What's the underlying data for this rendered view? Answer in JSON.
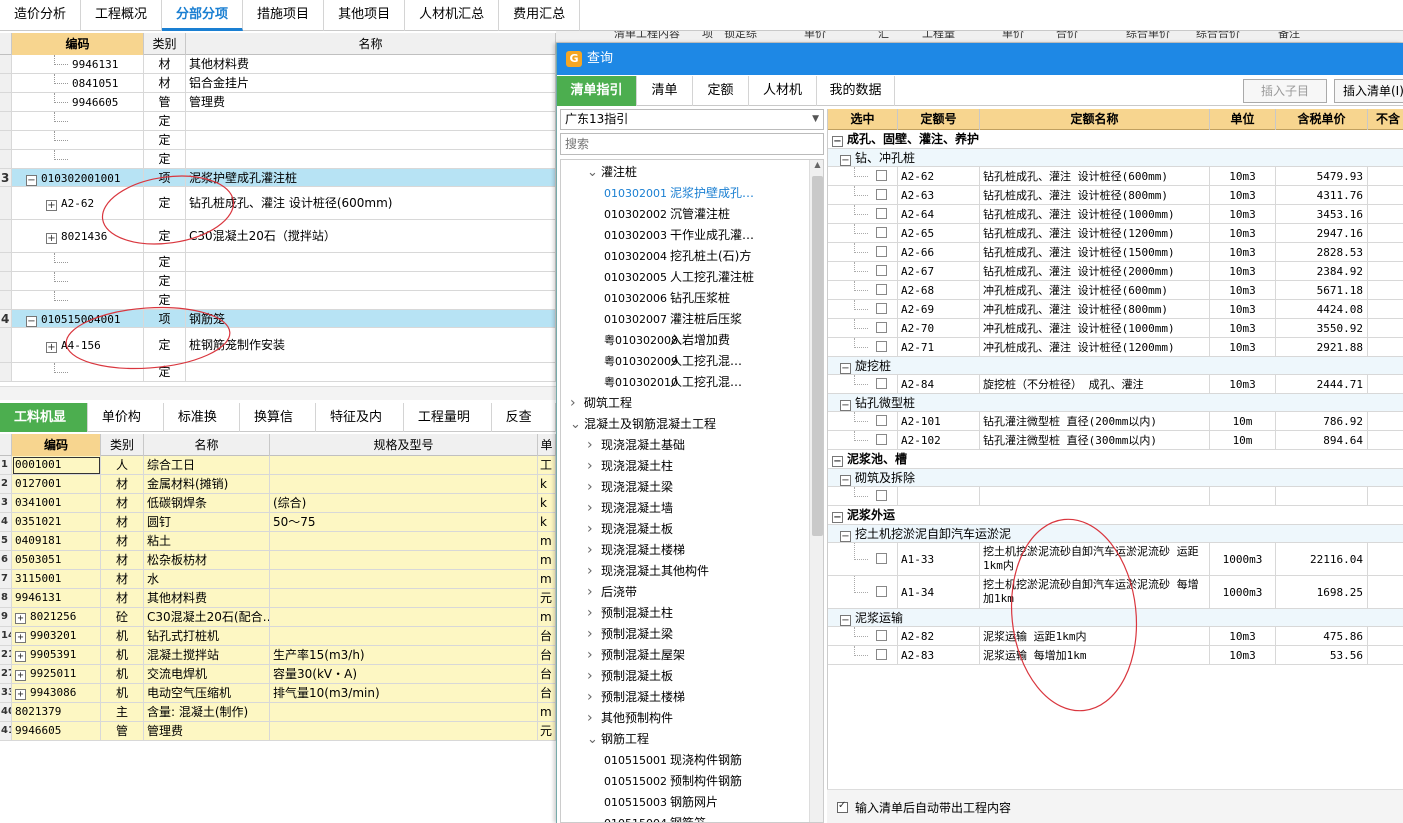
{
  "top_tabs": [
    "造价分析",
    "工程概况",
    "分部分项",
    "措施项目",
    "其他项目",
    "人材机汇总",
    "费用汇总"
  ],
  "upper_grid": {
    "headers": {
      "code": "编码",
      "type": "类别",
      "name": "名称"
    },
    "rows": [
      {
        "rn": "",
        "code": "9946131",
        "type": "材",
        "name": "其他材料费"
      },
      {
        "rn": "",
        "code": "0841051",
        "type": "材",
        "name": "铝合金挂片"
      },
      {
        "rn": "",
        "code": "9946605",
        "type": "管",
        "name": "管理费"
      },
      {
        "rn": "",
        "code": "",
        "type": "定",
        "name": ""
      },
      {
        "rn": "",
        "code": "",
        "type": "定",
        "name": ""
      },
      {
        "rn": "",
        "code": "",
        "type": "定",
        "name": ""
      },
      {
        "rn": "3",
        "code": "010302001001",
        "type": "项",
        "name": "泥浆护壁成孔灌注桩"
      },
      {
        "rn": "",
        "code": "A2-62",
        "type": "定",
        "name": "钻孔桩成孔、灌注 设计桩径(600mm)"
      },
      {
        "rn": "",
        "code": "8021436",
        "type": "定",
        "name": "C30混凝土20石（搅拌站）"
      },
      {
        "rn": "",
        "code": "",
        "type": "定",
        "name": ""
      },
      {
        "rn": "",
        "code": "",
        "type": "定",
        "name": ""
      },
      {
        "rn": "",
        "code": "",
        "type": "定",
        "name": ""
      },
      {
        "rn": "4",
        "code": "010515004001",
        "type": "项",
        "name": "钢筋笼"
      },
      {
        "rn": "",
        "code": "A4-156",
        "type": "定",
        "name": "桩钢筋笼制作安装"
      },
      {
        "rn": "",
        "code": "",
        "type": "定",
        "name": ""
      }
    ]
  },
  "lower_tabs": [
    "工料机显示",
    "单价构成",
    "标准换算",
    "换算信息",
    "特征及内容",
    "工程量明细",
    "反查图"
  ],
  "lower_grid": {
    "headers": {
      "code": "编码",
      "type": "类别",
      "name": "名称",
      "spec": "规格及型号",
      "unit": "单"
    },
    "rows": [
      {
        "rn": "1",
        "code": "0001001",
        "type": "人",
        "name": "综合工日",
        "spec": "",
        "unit": "工"
      },
      {
        "rn": "2",
        "code": "0127001",
        "type": "材",
        "name": "金属材料(摊销)",
        "spec": "",
        "unit": "k"
      },
      {
        "rn": "3",
        "code": "0341001",
        "type": "材",
        "name": "低碳钢焊条",
        "spec": "(综合)",
        "unit": "k"
      },
      {
        "rn": "4",
        "code": "0351021",
        "type": "材",
        "name": "圆钉",
        "spec": "50～75",
        "unit": "k"
      },
      {
        "rn": "5",
        "code": "0409181",
        "type": "材",
        "name": "粘土",
        "spec": "",
        "unit": "m"
      },
      {
        "rn": "6",
        "code": "0503051",
        "type": "材",
        "name": "松杂板枋材",
        "spec": "",
        "unit": "m"
      },
      {
        "rn": "7",
        "code": "3115001",
        "type": "材",
        "name": "水",
        "spec": "",
        "unit": "m"
      },
      {
        "rn": "8",
        "code": "9946131",
        "type": "材",
        "name": "其他材料费",
        "spec": "",
        "unit": "元"
      },
      {
        "rn": "9",
        "code": "8021256",
        "type": "砼",
        "name": "C30混凝土20石(配合…",
        "spec": "",
        "unit": "m"
      },
      {
        "rn": "14",
        "code": "9903201",
        "type": "机",
        "name": "钻孔式打桩机",
        "spec": "",
        "unit": "台"
      },
      {
        "rn": "21",
        "code": "9905391",
        "type": "机",
        "name": "混凝土搅拌站",
        "spec": "生产率15(m3/h)",
        "unit": "台"
      },
      {
        "rn": "27",
        "code": "9925011",
        "type": "机",
        "name": "交流电焊机",
        "spec": "容量30(kV・A)",
        "unit": "台"
      },
      {
        "rn": "33",
        "code": "9943086",
        "type": "机",
        "name": "电动空气压缩机",
        "spec": "排气量10(m3/min)",
        "unit": "台"
      },
      {
        "rn": "40",
        "code": "8021379",
        "type": "主",
        "name": "含量: 混凝土(制作)",
        "spec": "",
        "unit": "m"
      },
      {
        "rn": "41",
        "code": "9946605",
        "type": "管",
        "name": "管理费",
        "spec": "",
        "unit": "元"
      }
    ]
  },
  "behind_header": [
    "清单工程内容",
    "项",
    "锁定综",
    "单价",
    "汇",
    "工程量",
    "单价",
    "合价",
    "综合单价",
    "综合合价",
    "备注"
  ],
  "dialog": {
    "title": "查询",
    "tabs": [
      "清单指引",
      "清单",
      "定额",
      "人材机",
      "我的数据"
    ],
    "btn_insert_sub": "插入子目",
    "btn_insert_list": "插入清单(I)",
    "guide_select": "广东13指引",
    "search_placeholder": "搜索",
    "tree": [
      {
        "indent": 3,
        "arrow": "open",
        "code": "",
        "label": "灌注桩",
        "active": false
      },
      {
        "indent": 4,
        "arrow": "",
        "code": "010302001",
        "label": "泥浆护壁成孔…",
        "active": true
      },
      {
        "indent": 4,
        "arrow": "",
        "code": "010302002",
        "label": "沉管灌注桩",
        "active": false
      },
      {
        "indent": 4,
        "arrow": "",
        "code": "010302003",
        "label": "干作业成孔灌…",
        "active": false
      },
      {
        "indent": 4,
        "arrow": "",
        "code": "010302004",
        "label": "挖孔桩土(石)方",
        "active": false
      },
      {
        "indent": 4,
        "arrow": "",
        "code": "010302005",
        "label": "人工挖孔灌注桩",
        "active": false
      },
      {
        "indent": 4,
        "arrow": "",
        "code": "010302006",
        "label": "钻孔压浆桩",
        "active": false
      },
      {
        "indent": 4,
        "arrow": "",
        "code": "010302007",
        "label": "灌注桩后压浆",
        "active": false
      },
      {
        "indent": 4,
        "arrow": "",
        "code": "粤010302008",
        "label": "入岩增加费",
        "active": false
      },
      {
        "indent": 4,
        "arrow": "",
        "code": "粤010302009",
        "label": "人工挖孔混…",
        "active": false
      },
      {
        "indent": 4,
        "arrow": "",
        "code": "粤010302010",
        "label": "人工挖孔混…",
        "active": false
      },
      {
        "indent": 2,
        "arrow": "closed",
        "code": "",
        "label": "砌筑工程",
        "active": false
      },
      {
        "indent": 2,
        "arrow": "open",
        "code": "",
        "label": "混凝土及钢筋混凝土工程",
        "active": false
      },
      {
        "indent": 3,
        "arrow": "closed",
        "code": "",
        "label": "现浇混凝土基础",
        "active": false
      },
      {
        "indent": 3,
        "arrow": "closed",
        "code": "",
        "label": "现浇混凝土柱",
        "active": false
      },
      {
        "indent": 3,
        "arrow": "closed",
        "code": "",
        "label": "现浇混凝土梁",
        "active": false
      },
      {
        "indent": 3,
        "arrow": "closed",
        "code": "",
        "label": "现浇混凝土墙",
        "active": false
      },
      {
        "indent": 3,
        "arrow": "closed",
        "code": "",
        "label": "现浇混凝土板",
        "active": false
      },
      {
        "indent": 3,
        "arrow": "closed",
        "code": "",
        "label": "现浇混凝土楼梯",
        "active": false
      },
      {
        "indent": 3,
        "arrow": "closed",
        "code": "",
        "label": "现浇混凝土其他构件",
        "active": false
      },
      {
        "indent": 3,
        "arrow": "closed",
        "code": "",
        "label": "后浇带",
        "active": false
      },
      {
        "indent": 3,
        "arrow": "closed",
        "code": "",
        "label": "预制混凝土柱",
        "active": false
      },
      {
        "indent": 3,
        "arrow": "closed",
        "code": "",
        "label": "预制混凝土梁",
        "active": false
      },
      {
        "indent": 3,
        "arrow": "closed",
        "code": "",
        "label": "预制混凝土屋架",
        "active": false
      },
      {
        "indent": 3,
        "arrow": "closed",
        "code": "",
        "label": "预制混凝土板",
        "active": false
      },
      {
        "indent": 3,
        "arrow": "closed",
        "code": "",
        "label": "预制混凝土楼梯",
        "active": false
      },
      {
        "indent": 3,
        "arrow": "closed",
        "code": "",
        "label": "其他预制构件",
        "active": false
      },
      {
        "indent": 3,
        "arrow": "open",
        "code": "",
        "label": "钢筋工程",
        "active": false
      },
      {
        "indent": 4,
        "arrow": "",
        "code": "010515001",
        "label": "现浇构件钢筋",
        "active": false
      },
      {
        "indent": 4,
        "arrow": "",
        "code": "010515002",
        "label": "预制构件钢筋",
        "active": false
      },
      {
        "indent": 4,
        "arrow": "",
        "code": "010515003",
        "label": "钢筋网片",
        "active": false
      },
      {
        "indent": 4,
        "arrow": "",
        "code": "010515004",
        "label": "钢筋笼",
        "active": false
      }
    ],
    "table_headers": {
      "select": "选中",
      "code": "定额号",
      "name": "定额名称",
      "unit": "单位",
      "price": "含税单价",
      "extra": "不含"
    },
    "table": [
      {
        "kind": "group",
        "label": "成孔、固壁、灌注、养护"
      },
      {
        "kind": "sub",
        "label": "钻、冲孔桩"
      },
      {
        "kind": "row",
        "code": "A2-62",
        "name": "钻孔桩成孔、灌注 设计桩径(600mm)",
        "unit": "10m3",
        "price": "5479.93"
      },
      {
        "kind": "row",
        "code": "A2-63",
        "name": "钻孔桩成孔、灌注 设计桩径(800mm)",
        "unit": "10m3",
        "price": "4311.76"
      },
      {
        "kind": "row",
        "code": "A2-64",
        "name": "钻孔桩成孔、灌注 设计桩径(1000mm)",
        "unit": "10m3",
        "price": "3453.16"
      },
      {
        "kind": "row",
        "code": "A2-65",
        "name": "钻孔桩成孔、灌注 设计桩径(1200mm)",
        "unit": "10m3",
        "price": "2947.16"
      },
      {
        "kind": "row",
        "code": "A2-66",
        "name": "钻孔桩成孔、灌注 设计桩径(1500mm)",
        "unit": "10m3",
        "price": "2828.53"
      },
      {
        "kind": "row",
        "code": "A2-67",
        "name": "钻孔桩成孔、灌注 设计桩径(2000mm)",
        "unit": "10m3",
        "price": "2384.92"
      },
      {
        "kind": "row",
        "code": "A2-68",
        "name": "冲孔桩成孔、灌注 设计桩径(600mm)",
        "unit": "10m3",
        "price": "5671.18"
      },
      {
        "kind": "row",
        "code": "A2-69",
        "name": "冲孔桩成孔、灌注 设计桩径(800mm)",
        "unit": "10m3",
        "price": "4424.08"
      },
      {
        "kind": "row",
        "code": "A2-70",
        "name": "冲孔桩成孔、灌注 设计桩径(1000mm)",
        "unit": "10m3",
        "price": "3550.92"
      },
      {
        "kind": "row",
        "code": "A2-71",
        "name": "冲孔桩成孔、灌注 设计桩径(1200mm)",
        "unit": "10m3",
        "price": "2921.88"
      },
      {
        "kind": "sub",
        "label": "旋挖桩"
      },
      {
        "kind": "row",
        "code": "A2-84",
        "name": "旋挖桩（不分桩径） 成孔、灌注",
        "unit": "10m3",
        "price": "2444.71"
      },
      {
        "kind": "sub",
        "label": "钻孔微型桩"
      },
      {
        "kind": "row",
        "code": "A2-101",
        "name": "钻孔灌注微型桩 直径(200mm以内)",
        "unit": "10m",
        "price": "786.92"
      },
      {
        "kind": "row",
        "code": "A2-102",
        "name": "钻孔灌注微型桩 直径(300mm以内)",
        "unit": "10m",
        "price": "894.64"
      },
      {
        "kind": "group",
        "label": "泥浆池、槽"
      },
      {
        "kind": "sub",
        "label": "砌筑及拆除"
      },
      {
        "kind": "row",
        "code": "",
        "name": "",
        "unit": "",
        "price": ""
      },
      {
        "kind": "group",
        "label": "泥浆外运"
      },
      {
        "kind": "sub",
        "label": "挖土机挖淤泥自卸汽车运淤泥"
      },
      {
        "kind": "row2",
        "code": "A1-33",
        "name": "挖土机挖淤泥流砂自卸汽车运淤泥流砂 运距1km内",
        "unit": "1000m3",
        "price": "22116.04"
      },
      {
        "kind": "row2",
        "code": "A1-34",
        "name": "挖土机挖淤泥流砂自卸汽车运淤泥流砂 每增加1km",
        "unit": "1000m3",
        "price": "1698.25"
      },
      {
        "kind": "sub",
        "label": "泥浆运输"
      },
      {
        "kind": "row",
        "code": "A2-82",
        "name": "泥浆运输 运距1km内",
        "unit": "10m3",
        "price": "475.86"
      },
      {
        "kind": "row",
        "code": "A2-83",
        "name": "泥浆运输 每增加1km",
        "unit": "10m3",
        "price": "53.56"
      }
    ],
    "footer_check": "输入清单后自动带出工程内容"
  },
  "annotation_color": "#d9363e",
  "accent_green": "#4cae4f",
  "accent_blue": "#1e88e5"
}
